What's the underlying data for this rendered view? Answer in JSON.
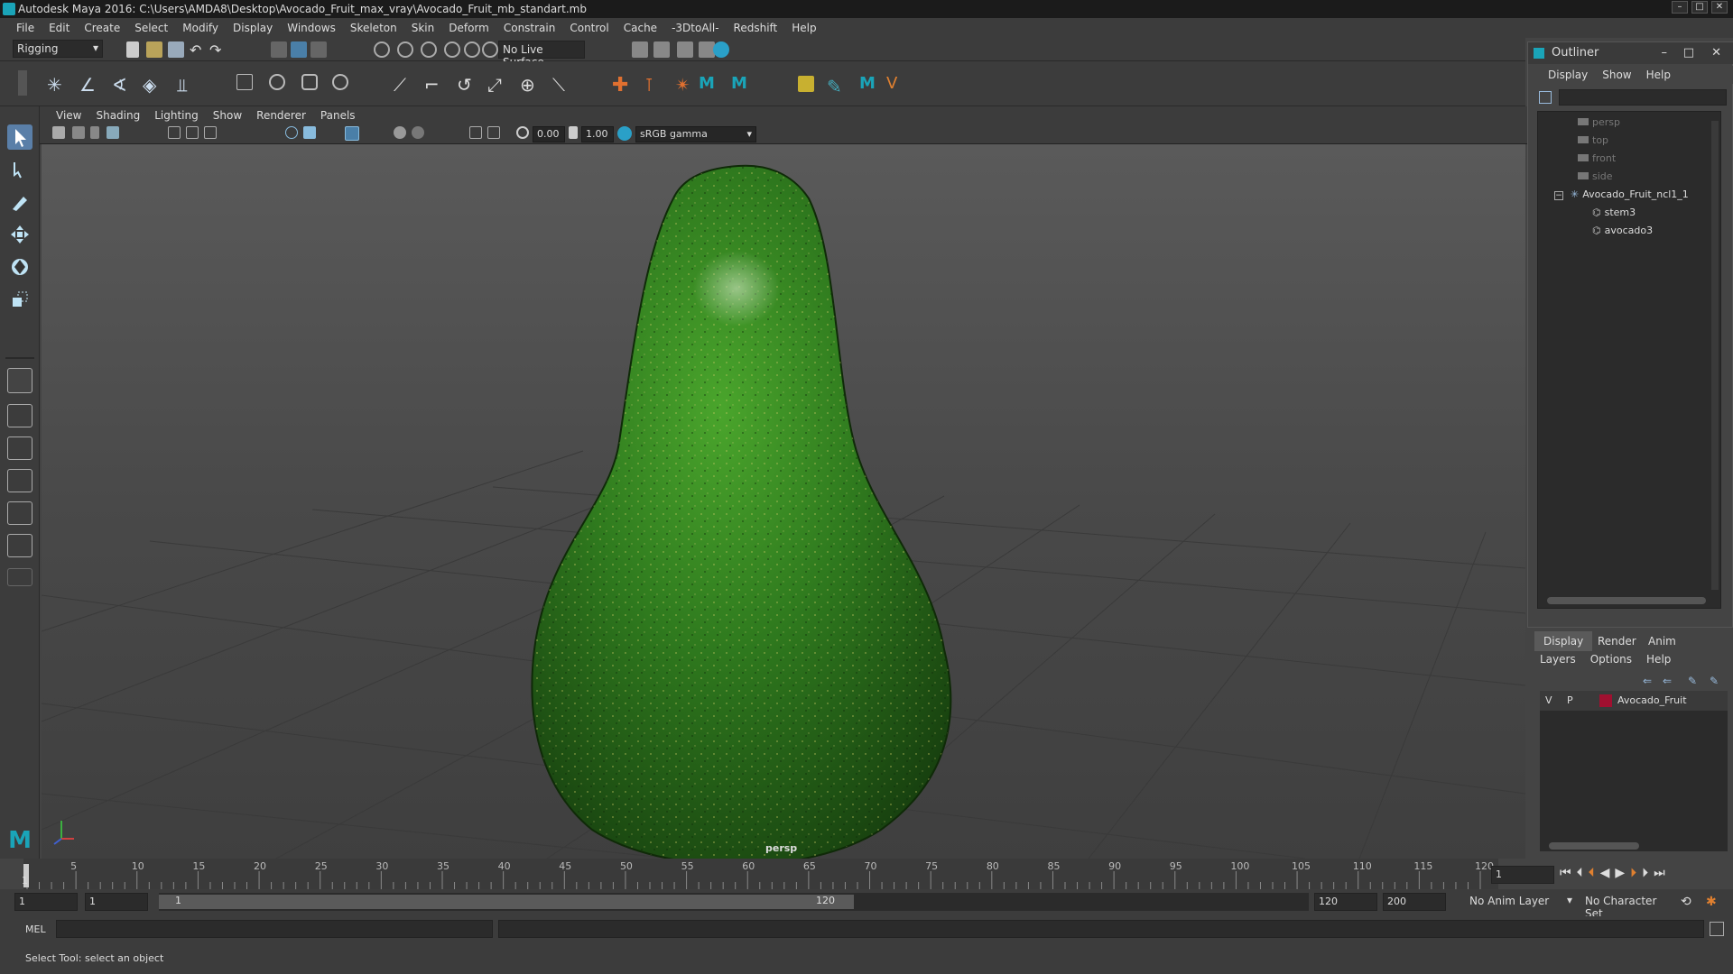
{
  "window": {
    "title": "Autodesk Maya 2016: C:\\Users\\AMDA8\\Desktop\\Avocado_Fruit_max_vray\\Avocado_Fruit_mb_standart.mb",
    "buttons": [
      "minimize",
      "maximize",
      "close"
    ]
  },
  "menubar": [
    "File",
    "Edit",
    "Create",
    "Select",
    "Modify",
    "Display",
    "Windows",
    "Skeleton",
    "Skin",
    "Deform",
    "Constrain",
    "Control",
    "Cache",
    "-3DtoAll-",
    "Redshift",
    "Help"
  ],
  "statusline": {
    "menuset": "Rigging",
    "live_surface": "No Live Surface"
  },
  "panel": {
    "menus": [
      "View",
      "Shading",
      "Lighting",
      "Show",
      "Renderer",
      "Panels"
    ],
    "exposure": "0.00",
    "gamma": "1.00",
    "colorspace": "sRGB gamma",
    "camera_label": "persp"
  },
  "outliner": {
    "title": "Outliner",
    "menus": [
      "Display",
      "Show",
      "Help"
    ],
    "items": [
      {
        "label": "persp",
        "dim": true
      },
      {
        "label": "top",
        "dim": true
      },
      {
        "label": "front",
        "dim": true
      },
      {
        "label": "side",
        "dim": true
      },
      {
        "label": "Avocado_Fruit_ncl1_1",
        "dim": false
      },
      {
        "label": "stem3",
        "dim": false
      },
      {
        "label": "avocado3",
        "dim": false
      }
    ]
  },
  "layers": {
    "tabs": [
      "Display",
      "Render",
      "Anim"
    ],
    "menus": [
      "Layers",
      "Options",
      "Help"
    ],
    "rows": [
      {
        "v": "V",
        "p": "P",
        "name": "Avocado_Fruit",
        "color": "#a01030"
      }
    ]
  },
  "timeline": {
    "ticks": [
      "5",
      "10",
      "15",
      "20",
      "25",
      "30",
      "35",
      "40",
      "45",
      "50",
      "55",
      "60",
      "65",
      "70",
      "75",
      "80",
      "85",
      "90",
      "95",
      "100",
      "105",
      "110",
      "115",
      "120"
    ],
    "current_frame": "1",
    "frame_field": "1"
  },
  "range": {
    "start": "1",
    "playback_start": "1",
    "slider_start": "1",
    "slider_end": "120",
    "playback_end": "120",
    "end": "200",
    "anim_layer": "No Anim Layer",
    "char_set": "No Character Set"
  },
  "cmdline": {
    "label": "MEL"
  },
  "helpline": {
    "text": "Select Tool: select an object"
  },
  "colors": {
    "avocado_dark": "#1c4a12",
    "avocado_mid": "#2f7a1e",
    "avocado_light": "#4aa52c",
    "layer_red": "#a01030",
    "maya_teal": "#1aa4b8"
  }
}
